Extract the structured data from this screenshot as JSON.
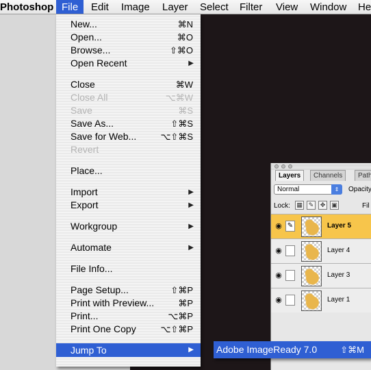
{
  "menubar": {
    "app": "Photoshop",
    "items": [
      "File",
      "Edit",
      "Image",
      "Layer",
      "Select",
      "Filter",
      "View",
      "Window",
      "He"
    ],
    "active": "File"
  },
  "file_menu": {
    "items": [
      {
        "label": "New...",
        "shortcut": "⌘N"
      },
      {
        "label": "Open...",
        "shortcut": "⌘O"
      },
      {
        "label": "Browse...",
        "shortcut": "⇧⌘O"
      },
      {
        "label": "Open Recent",
        "submenu": true
      },
      {
        "label": "Close",
        "shortcut": "⌘W"
      },
      {
        "label": "Close All",
        "shortcut": "⌥⌘W",
        "disabled": true
      },
      {
        "label": "Save",
        "shortcut": "⌘S",
        "disabled": true
      },
      {
        "label": "Save As...",
        "shortcut": "⇧⌘S"
      },
      {
        "label": "Save for Web...",
        "shortcut": "⌥⇧⌘S"
      },
      {
        "label": "Revert",
        "disabled": true
      },
      {
        "label": "Place..."
      },
      {
        "label": "Import",
        "submenu": true
      },
      {
        "label": "Export",
        "submenu": true
      },
      {
        "label": "Workgroup",
        "submenu": true
      },
      {
        "label": "Automate",
        "submenu": true
      },
      {
        "label": "File Info..."
      },
      {
        "label": "Page Setup...",
        "shortcut": "⇧⌘P"
      },
      {
        "label": "Print with Preview...",
        "shortcut": "⌘P"
      },
      {
        "label": "Print...",
        "shortcut": "⌥⌘P"
      },
      {
        "label": "Print One Copy",
        "shortcut": "⌥⇧⌘P"
      },
      {
        "label": "Jump To",
        "submenu": true,
        "highlighted": true
      }
    ]
  },
  "submenu": {
    "label": "Adobe ImageReady 7.0",
    "shortcut": "⇧⌘M"
  },
  "layers_panel": {
    "tabs": [
      "Layers",
      "Channels",
      "Path"
    ],
    "active_tab": "Layers",
    "blend_mode": "Normal",
    "opacity_label": "Opacity",
    "lock_label": "Lock:",
    "fill_label": "Fil",
    "layers": [
      {
        "name": "Layer 5",
        "selected": true
      },
      {
        "name": "Layer 4"
      },
      {
        "name": "Layer 3"
      },
      {
        "name": "Layer 1"
      }
    ]
  },
  "colors": {
    "accent": "#2f5fd3",
    "selected_layer": "#f7c54b",
    "desktop": "#1d1618"
  }
}
